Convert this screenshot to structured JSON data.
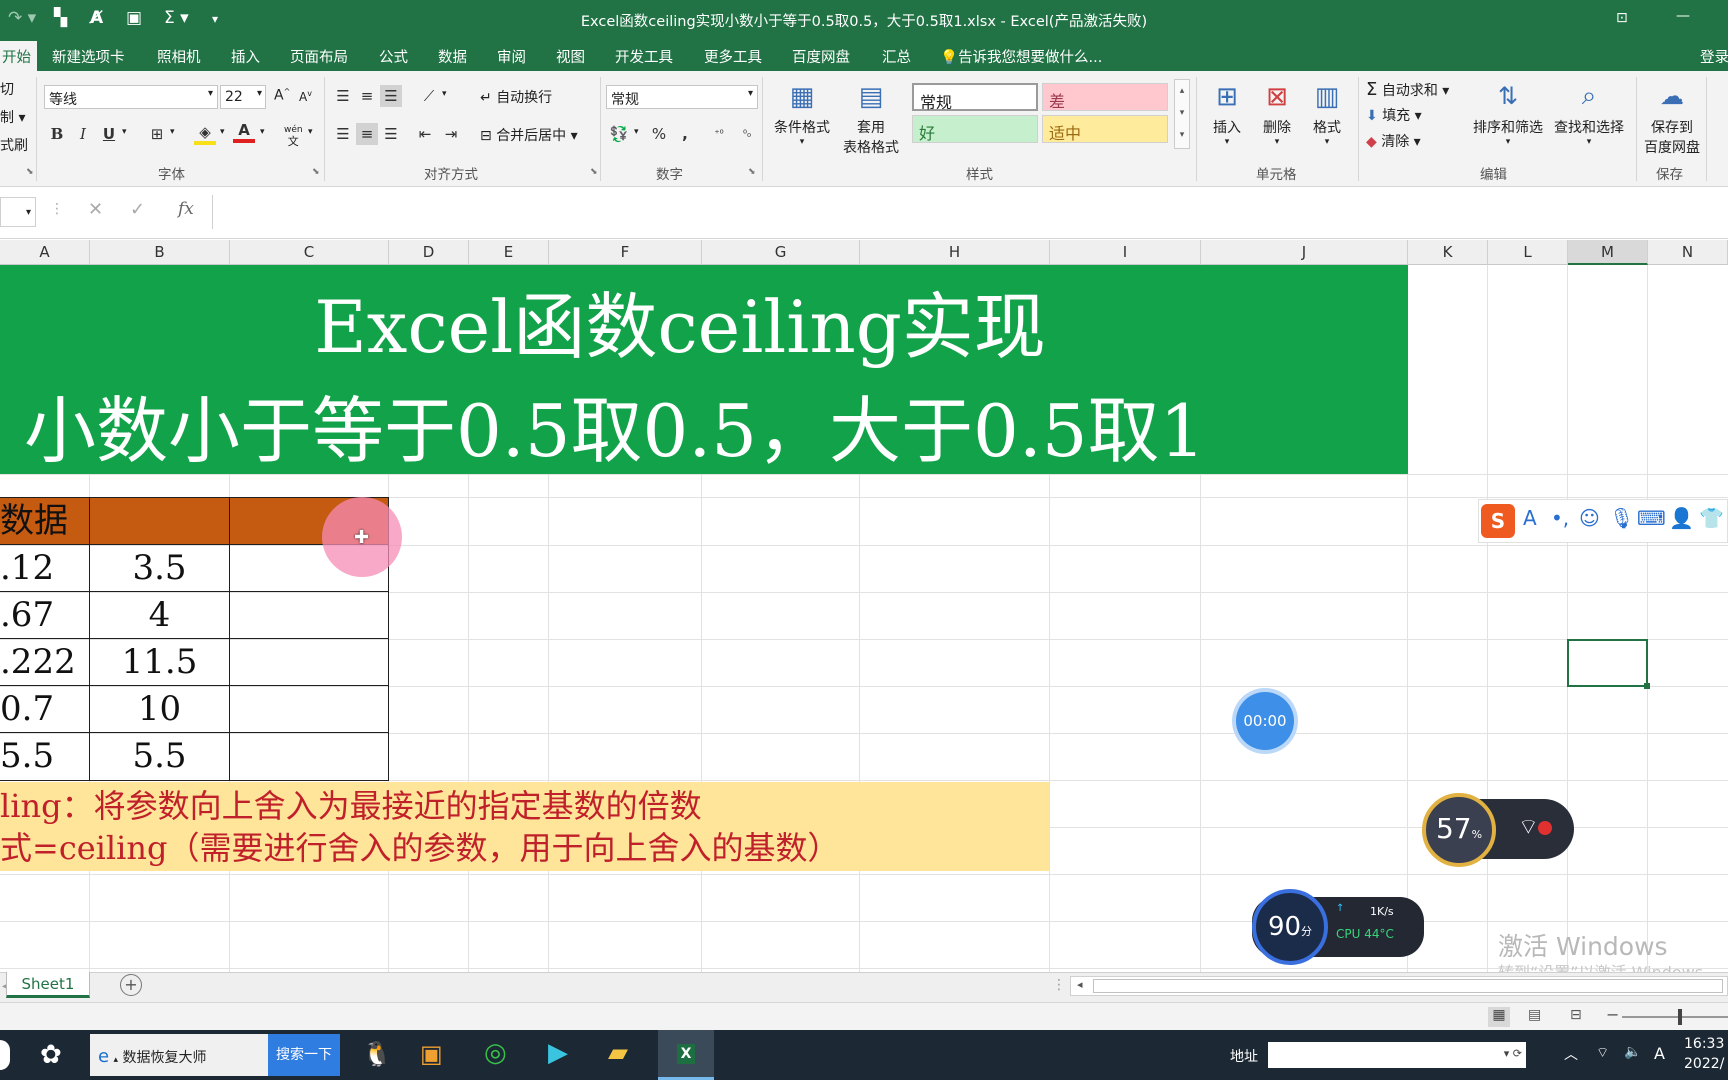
{
  "window": {
    "title": "Excel函数ceiling实现小数小于等于0.5取0.5，大于0.5取1.xlsx - Excel(产品激活失败)",
    "quick_access": [
      "undo-icon",
      "save-icon",
      "format-icon",
      "table-icon",
      "sum-icon",
      "more-icon"
    ],
    "sum_glyph": "Σ",
    "login_label": "登录"
  },
  "menu": {
    "tabs": [
      "开始",
      "新建选项卡",
      "照相机",
      "插入",
      "页面布局",
      "公式",
      "数据",
      "审阅",
      "视图",
      "开发工具",
      "更多工具",
      "百度网盘",
      "汇总"
    ],
    "tell_me": "告诉我您想要做什么..."
  },
  "ribbon": {
    "clipboard": {
      "cut": "切",
      "copy": "制",
      "painter": "式刷"
    },
    "font": {
      "name": "等线",
      "size": "22",
      "bold": "B",
      "italic": "I",
      "underline": "U",
      "group_label": "字体",
      "grow": "A",
      "wen": "文",
      "pinyin": "wén"
    },
    "alignment": {
      "wrap": "自动换行",
      "merge": "合并后居中",
      "group_label": "对齐方式"
    },
    "number": {
      "format": "常规",
      "percent": "%",
      "comma": ",",
      "group_label": "数字"
    },
    "styles": {
      "cond_format": "条件格式",
      "table_format": [
        "套用",
        "表格格式"
      ],
      "normal": "常规",
      "bad": "差",
      "good": "好",
      "neutral": "适中",
      "group_label": "样式"
    },
    "cells": {
      "insert": "插入",
      "delete": "删除",
      "format": "格式",
      "group_label": "单元格"
    },
    "editing": {
      "autosum": "自动求和",
      "fill": "填充",
      "clear": "清除",
      "sort_filter": "排序和筛选",
      "find_select": "查找和选择",
      "group_label": "编辑"
    },
    "save": {
      "save_to": [
        "保存到",
        "百度网盘"
      ],
      "group_label": "保存"
    }
  },
  "formula_bar": {
    "fx": "fx",
    "value": ""
  },
  "columns": [
    "A",
    "B",
    "C",
    "D",
    "E",
    "F",
    "G",
    "H",
    "I",
    "J",
    "K",
    "L",
    "M",
    "N"
  ],
  "sheet": {
    "banner_line1": "Excel函数ceiling实现",
    "banner_line2": "小数小于等于0.5取0.5，大于0.5取1",
    "table_header": "数据",
    "rows": [
      {
        "a": ".12",
        "b": "3.5"
      },
      {
        "a": ".67",
        "b": "4"
      },
      {
        "a": ".222",
        "b": "11.5"
      },
      {
        "a": "0.7",
        "b": "10"
      },
      {
        "a": "5.5",
        "b": "5.5"
      }
    ],
    "note_line1": "ling：将参数向上舍入为最接近的指定基数的倍数",
    "note_line2": "式=ceiling（需要进行舍入的参数，用于向上舍入的基数）"
  },
  "overlays": {
    "timer": "00:00",
    "mem_percent": "57",
    "mem_unit": "%",
    "score": "90",
    "score_unit": "分",
    "net_speed": "1K/s",
    "cpu": "CPU 44°C",
    "activate_title": "激活 Windows",
    "activate_sub": "转到“设置”以激活 Windows。"
  },
  "sheet_tabs": [
    "Sheet1"
  ],
  "taskbar": {
    "app_label": "数据恢复大师",
    "search_button": "搜索一下",
    "address_label": "地址",
    "time": "16:33",
    "date": "2022/"
  },
  "colors": {
    "excel_green": "#217346",
    "banner_green": "#12a34a",
    "header_orange": "#c55a11",
    "note_yellow": "#ffe59a",
    "note_red": "#c0202a"
  }
}
